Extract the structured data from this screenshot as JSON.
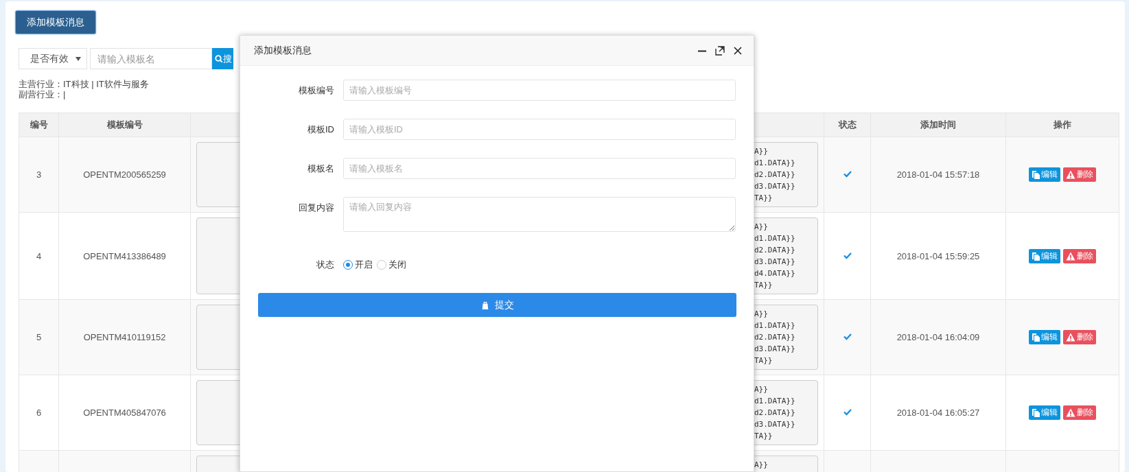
{
  "add_button": "添加模板消息",
  "filter": {
    "select": "是否有效",
    "search_placeholder": "请输入模板名",
    "search_button": "搜"
  },
  "industry": {
    "primary": "主营行业：IT科技 | IT软件与服务",
    "secondary": "副营行业：|"
  },
  "table": {
    "columns": [
      "编号",
      "模板编号",
      "状态",
      "添加时间",
      "操作"
    ],
    "rows": [
      {
        "number": "3",
        "template_id": "OPENTM200565259",
        "column_3": [
          "A}}",
          "d1.DATA}}",
          "d2.DATA}}",
          "d3.DATA}}",
          "TA}}"
        ],
        "enabled": true,
        "added": "2018-01-04 15:57:18",
        "actions": [
          "编辑",
          "删除"
        ]
      },
      {
        "number": "4",
        "template_id": "OPENTM413386489",
        "column_3": [
          "A}}",
          "d1.DATA}}",
          "d2.DATA}}",
          "d3.DATA}}",
          "d4.DATA}}",
          "TA}}"
        ],
        "enabled": true,
        "added": "2018-01-04 15:59:25",
        "actions": [
          "编辑",
          "删除"
        ]
      },
      {
        "number": "5",
        "template_id": "OPENTM410119152",
        "column_3": [
          "A}}",
          "d1.DATA}}",
          "d2.DATA}}",
          "d3.DATA}}",
          "TA}}"
        ],
        "enabled": true,
        "added": "2018-01-04 16:04:09",
        "actions": [
          "编辑",
          "删除"
        ]
      },
      {
        "number": "6",
        "template_id": "OPENTM405847076",
        "column_3": [
          "A}}",
          "d1.DATA}}",
          "d2.DATA}}",
          "d3.DATA}}",
          "TA}}"
        ],
        "enabled": true,
        "added": "2018-01-04 16:05:27",
        "actions": [
          "编辑",
          "删除"
        ]
      },
      {
        "column_3": [
          "A}}"
        ]
      }
    ]
  },
  "modal": {
    "title": "添加模板消息",
    "fields": [
      {
        "kind": "text",
        "label": "模板编号",
        "placeholder": "请输入模板编号"
      },
      {
        "kind": "text",
        "label": "模板ID",
        "placeholder": "请输入模板ID"
      },
      {
        "kind": "text",
        "label": "模板名",
        "placeholder": "请输入模板名"
      },
      {
        "kind": "textarea",
        "label": "回复内容",
        "placeholder": "请输入回复内容"
      },
      {
        "kind": "radio",
        "label": "状态",
        "options": [
          {
            "label": "开启",
            "selected": true
          },
          {
            "label": "关闭",
            "selected": false
          }
        ]
      }
    ],
    "submit": "提交"
  }
}
